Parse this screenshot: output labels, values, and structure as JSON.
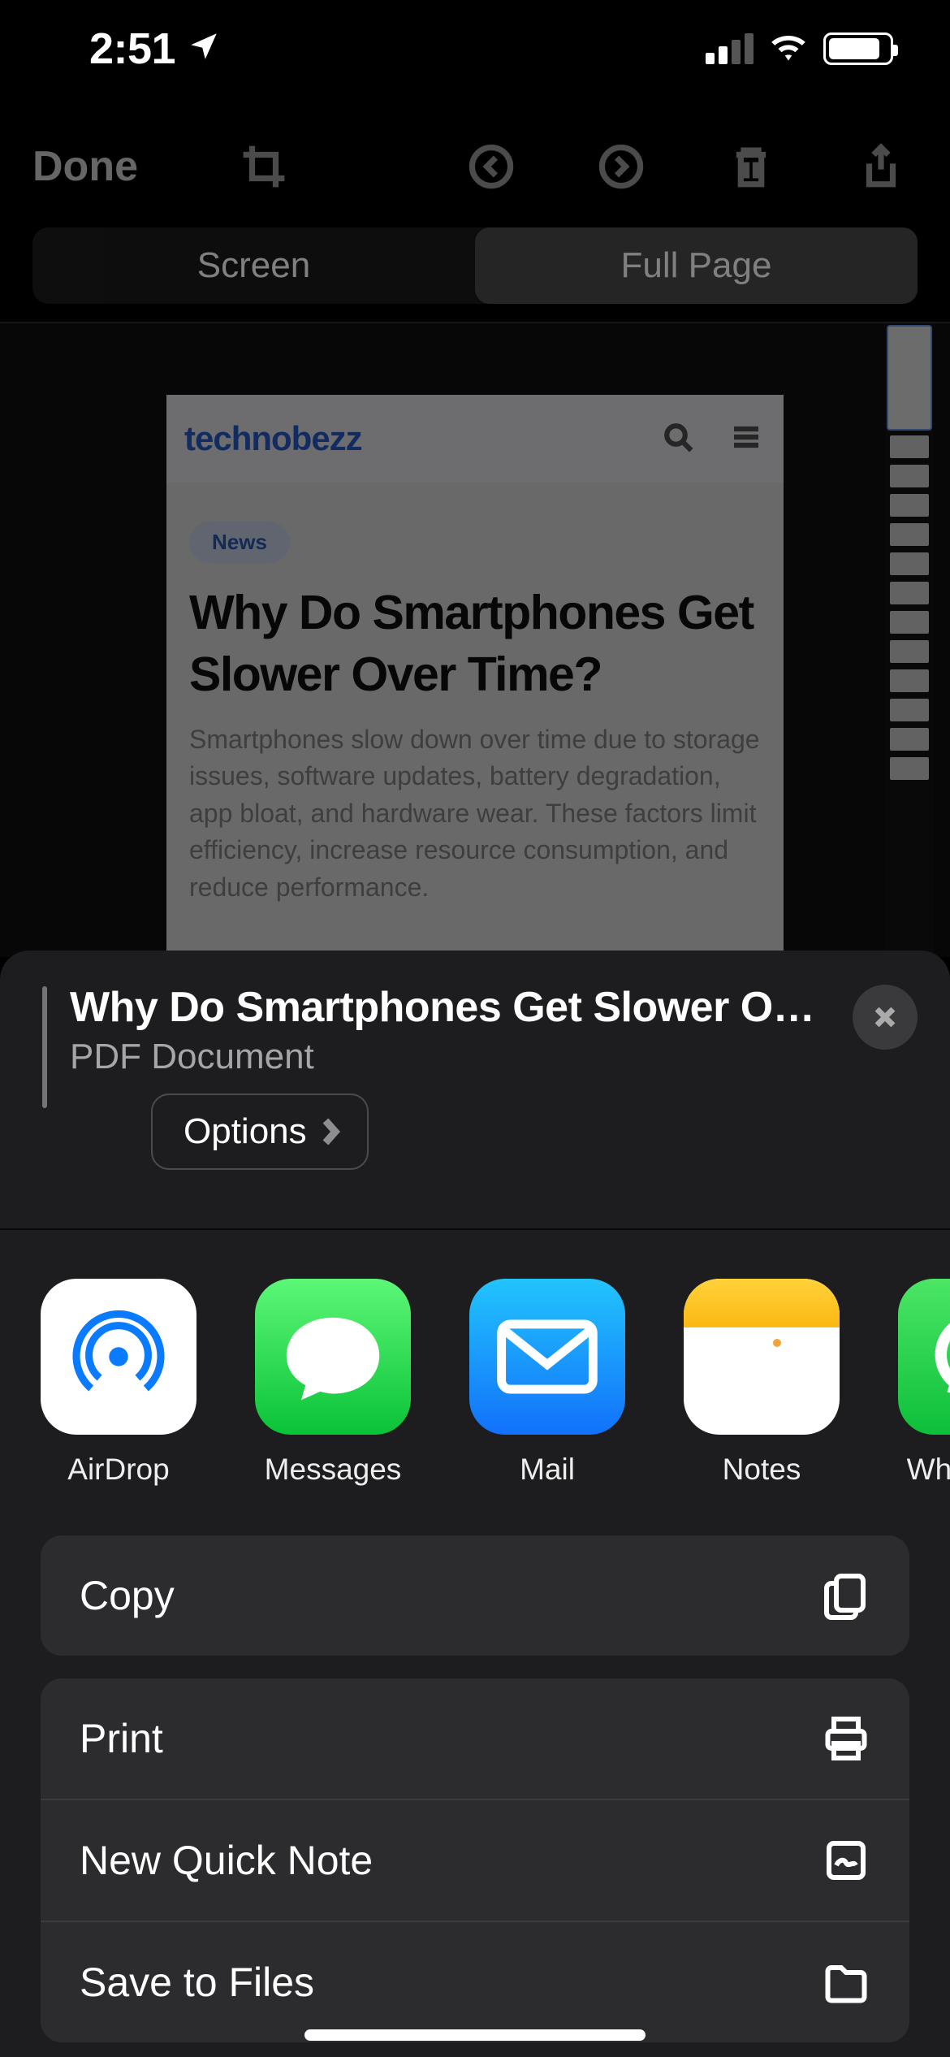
{
  "status": {
    "time": "2:51"
  },
  "edit": {
    "done": "Done"
  },
  "segmented": {
    "screen": "Screen",
    "full_page": "Full Page"
  },
  "article": {
    "brand": "technobezz",
    "badge": "News",
    "headline": "Why Do Smartphones Get Slower Over Time?",
    "sub": "Smartphones slow down over time due to storage issues, software updates, battery degradation, app bloat, and hardware wear. These factors limit efficiency, increase resource consumption, and reduce performance."
  },
  "share": {
    "title": "Why Do Smartphones Get Slower Ove…",
    "subtitle": "PDF Document",
    "options": "Options",
    "apps": {
      "airdrop": "AirDrop",
      "messages": "Messages",
      "mail": "Mail",
      "notes": "Notes",
      "whatsapp": "WhatsApp"
    },
    "actions": {
      "copy": "Copy",
      "print": "Print",
      "quick_note": "New Quick Note",
      "save_files": "Save to Files"
    }
  }
}
